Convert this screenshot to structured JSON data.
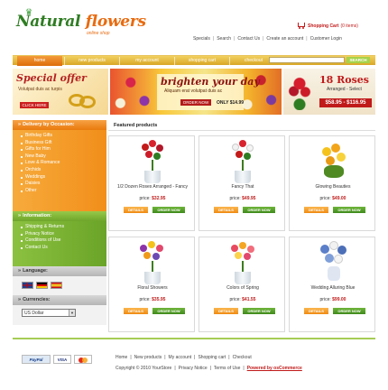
{
  "header": {
    "logo_title_main": "Natural",
    "logo_title_accent": "flowers",
    "logo_subtitle": "online shop",
    "cart_label": "Shopping Cart",
    "cart_count": "(0 items)",
    "links": [
      "Specials",
      "Search",
      "Contact Us",
      "Create an account",
      "Customer Login"
    ]
  },
  "nav": {
    "tabs": [
      "home",
      "new products",
      "my account",
      "shopping cart",
      "checkout"
    ],
    "search_button": "SEARCH",
    "search_value": ""
  },
  "banners": {
    "special": {
      "title": "Special offer",
      "subtitle": "Volutpat duis ac turpis",
      "button": "CLICK HERE"
    },
    "brighten": {
      "title": "brighten your day",
      "subtitle": "Aliquam erat volutpat duis ac",
      "button": "ORDER NOW",
      "price": "ONLY $14.99"
    },
    "roses": {
      "title": "18 Roses",
      "subtitle": "Arranged - Select",
      "price": "$58.95 - $116.95"
    }
  },
  "sidebar": {
    "delivery": {
      "title": "Delivery by Occasion:",
      "items": [
        "Birthday Gifts",
        "Business Gift",
        "Gifts for Him",
        "New Baby",
        "Love & Romance",
        "Orchids",
        "Weddings",
        "Daisies",
        "Other"
      ]
    },
    "information": {
      "title": "Information:",
      "items": [
        "Shipping & Returns",
        "Privacy Notice",
        "Conditions of Use",
        "Contact Us"
      ]
    },
    "language": {
      "title": "Language:"
    },
    "currencies": {
      "title": "Currencies:",
      "selected": "US Dollar"
    }
  },
  "products": {
    "title": "Featured products",
    "price_label": "price:",
    "details_label": "DETAILS",
    "order_label": "ORDER NOW",
    "items": [
      {
        "name": "1/2 Dozen Roses Arranged - Fancy",
        "price": "$32.95"
      },
      {
        "name": "Fancy That",
        "price": "$49.95"
      },
      {
        "name": "Glowing Beauties",
        "price": "$49.00"
      },
      {
        "name": "Floral Showers",
        "price": "$35.95"
      },
      {
        "name": "Colors of Spring",
        "price": "$41.55"
      },
      {
        "name": "Wedding Alluring Blue",
        "price": "$99.00"
      }
    ]
  },
  "footer": {
    "payments": {
      "paypal": "PayPal",
      "visa": "VISA"
    },
    "links": [
      "Home",
      "New products",
      "My account",
      "Shopping cart",
      "Checkout"
    ],
    "copyright": "Copyright © 2010 YourStore",
    "legal": [
      "Privacy Notice",
      "Terms of Use"
    ],
    "powered": "Powered by osCommerce"
  },
  "colors": {
    "green": "#2f7d23",
    "orange": "#e87a0e",
    "red": "#c01a1a",
    "lime": "#a6cc55"
  }
}
